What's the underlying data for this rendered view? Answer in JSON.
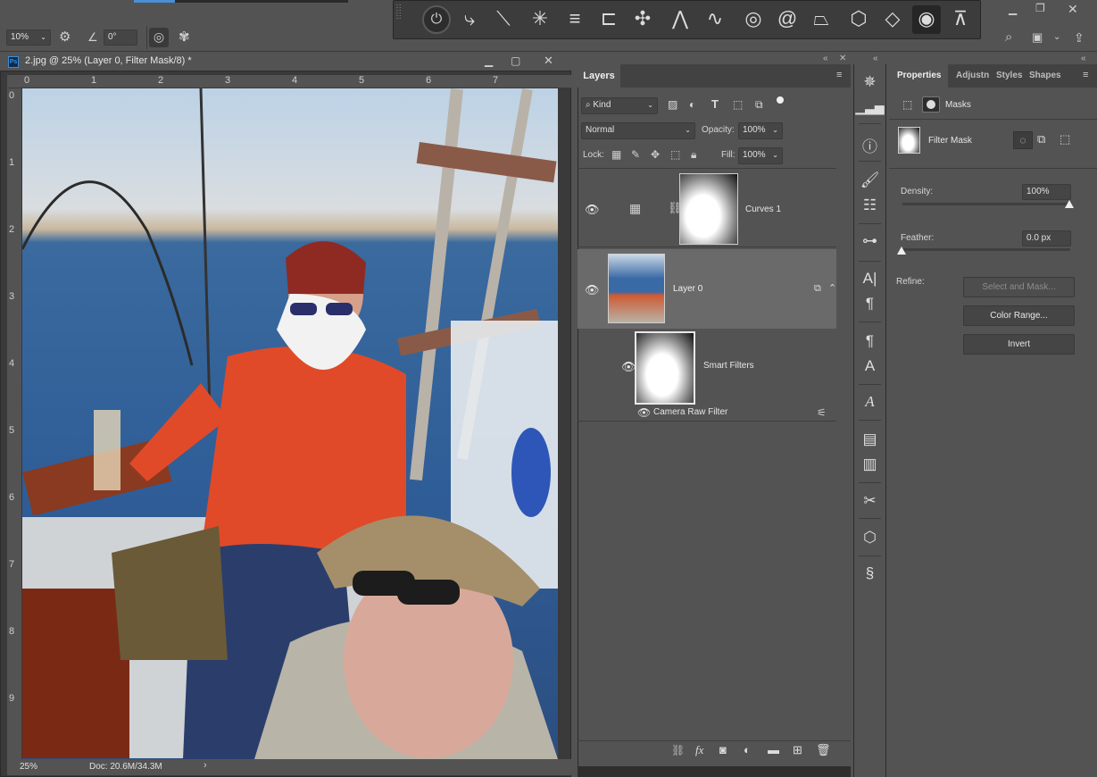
{
  "options_bar": {
    "zoom_value": "10%",
    "angle_value": "0°"
  },
  "document": {
    "title": "2.jpg @ 25% (Layer 0, Filter Mask/8) *",
    "ps_badge": "Ps",
    "ruler_h": [
      "0",
      "1",
      "2",
      "3",
      "4",
      "5",
      "6",
      "7"
    ],
    "ruler_v": [
      "0",
      "1",
      "2",
      "3",
      "4",
      "5",
      "6",
      "7",
      "8",
      "9"
    ],
    "status_zoom": "25%",
    "status_doc": "Doc: 20.6M/34.3M"
  },
  "layers_panel": {
    "tab_label": "Layers",
    "filter_kind": "Kind",
    "blend_mode": "Normal",
    "opacity_label": "Opacity:",
    "opacity_value": "100%",
    "lock_label": "Lock:",
    "fill_label": "Fill:",
    "fill_value": "100%",
    "layers": [
      {
        "name": "Curves 1"
      },
      {
        "name": "Layer 0"
      },
      {
        "name": "Smart Filters"
      },
      {
        "name": "Camera Raw Filter"
      }
    ]
  },
  "properties_panel": {
    "tabs": [
      "Properties",
      "Adjustn",
      "Styles",
      "Shapes"
    ],
    "section_title": "Masks",
    "mask_type": "Filter Mask",
    "density_label": "Density:",
    "density_value": "100%",
    "feather_label": "Feather:",
    "feather_value": "0.0 px",
    "refine_label": "Refine:",
    "select_mask_button": "Select and Mask...",
    "color_range_button": "Color Range...",
    "invert_button": "Invert"
  }
}
